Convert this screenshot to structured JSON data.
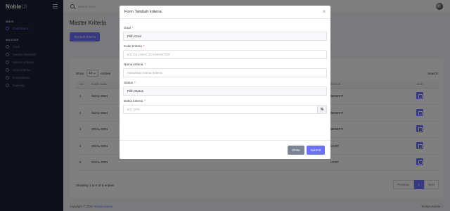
{
  "brand": {
    "name": "Noble",
    "suffix": "UI"
  },
  "sidebar": {
    "sections": [
      {
        "title": "MAIN",
        "items": [
          {
            "label": "Dashboard",
            "icon": "home-icon",
            "active": true
          }
        ]
      },
      {
        "title": "MASTER",
        "items": [
          {
            "label": "Goal",
            "icon": "target-icon"
          },
          {
            "label": "Master Alternatif",
            "icon": "list-icon"
          },
          {
            "label": "Master Kriteria",
            "icon": "list-icon"
          },
          {
            "label": "Nilai Kriteria",
            "icon": "edit-icon"
          },
          {
            "label": "Normalisasi",
            "icon": "calc-icon"
          },
          {
            "label": "Ranking",
            "icon": "chart-icon"
          }
        ]
      }
    ]
  },
  "topbar": {
    "search_placeholder": "Search here..."
  },
  "page": {
    "title": "Master Kriteria",
    "add_button": "Tambah kriteria",
    "show_prefix": "Show",
    "show_value": "10",
    "show_suffix": "entries",
    "search_label": "Search:",
    "columns": [
      "NO",
      "KODE GOAL",
      "STATUS",
      "AKSI"
    ],
    "rows": [
      {
        "no": "1",
        "kode": "GOAL-0001",
        "status": "BENEFIT"
      },
      {
        "no": "2",
        "kode": "GOAL-0001",
        "status": "BENEFIT"
      },
      {
        "no": "3",
        "kode": "GOAL-0001",
        "status": "BENEFIT"
      },
      {
        "no": "4",
        "kode": "GOAL-0001",
        "status": "COST"
      },
      {
        "no": "5",
        "kode": "GOAL-0001",
        "status": "COST"
      }
    ],
    "info": "Showing 1 to 5 of 5 entries",
    "pager": {
      "prev": "Previous",
      "current": "1",
      "next": "Next"
    },
    "footer_left": "Copyright © 2022",
    "footer_link": "TeddyLusanda",
    "footer_right": "TeddyLusanda"
  },
  "modal": {
    "title": "Form Tambah kriteria",
    "fields": {
      "goal": {
        "label": "Goal",
        "value": "Pilih Goal"
      },
      "kode": {
        "label": "Kode kriteria",
        "placeholder": "EX: C1 | MAX 20 KARAKTER"
      },
      "nama": {
        "label": "Nama kriteria",
        "placeholder": "Masukkan Nama kriteria"
      },
      "status": {
        "label": "Status",
        "value": "Pilih Status"
      },
      "bobot": {
        "label": "Bobot kriteria",
        "placeholder": "EX: 10%",
        "suffix": "%"
      }
    },
    "required_mark": "*",
    "close_button": "Close",
    "submit_button": "Submit"
  }
}
